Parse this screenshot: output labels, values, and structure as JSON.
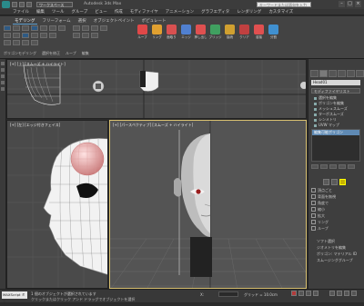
{
  "app": {
    "title": "Autodesk 3ds Max",
    "workspace": "ワークスペース"
  },
  "search": {
    "placeholder": "キーワードまたは語句を入力"
  },
  "menu": [
    "ファイル",
    "編集",
    "ツール",
    "グループ",
    "ビュー",
    "作成",
    "モディファイヤ",
    "アニメーション",
    "グラフエディタ",
    "レンダリング",
    "カスタマイズ"
  ],
  "ribbon": {
    "tabs": [
      "モデリング",
      "フリーフォーム",
      "選択",
      "オブジェクトペイント",
      "ポピュレート"
    ],
    "active_tab": 0,
    "tools": [
      "ループ",
      "リング",
      "面取り",
      "エッジ",
      "押し出し",
      "ブリッジ",
      "接続",
      "クリア",
      "溶接",
      "分割"
    ],
    "tool_colors": [
      "#e04848",
      "#e0a030",
      "#d85050",
      "#5080d0",
      "#e05050",
      "#40a060",
      "#d0a030",
      "#c04040",
      "#e05050",
      "#4090d0"
    ],
    "subtitles": [
      "ポリゴンモデリング",
      "選択を修正",
      "ループ",
      "編集"
    ]
  },
  "viewports": {
    "top": "[+] [上] [スムーズ + ハイライト]",
    "left": "[+] [左] [エッジ付きフェイス]",
    "perspective": "[+] [パースペクティブ] [スムーズ + ハイライト]"
  },
  "command_panel": {
    "object_name": "Head01",
    "modifier_list": "モディファイヤリスト",
    "modifiers": [
      "選択を編集",
      "ポリゴンを編集",
      "メッシュスムーズ",
      "ターボスムーズ",
      "シンメトリ",
      "UVW マップ"
    ],
    "stack_top": "編集可能ポリゴン",
    "selection_options": [
      "頂点ごと",
      "背面を無視",
      "角度で",
      "縮小",
      "拡大",
      "リング",
      "ループ"
    ],
    "bottom_items": [
      "ソフト選択",
      "ジオメトリを編集",
      "ポリゴン: マテリアル ID",
      "スムージンググループ"
    ]
  },
  "status": {
    "script_label": "MAXScript ミニ",
    "line1": "1 個のオブジェクトが選択されています",
    "line2": "クリックまたはクリック アンド ドラッグでオブジェクトを選択",
    "coord_label": "X:",
    "grid": "グリッド = 10.0cm"
  }
}
